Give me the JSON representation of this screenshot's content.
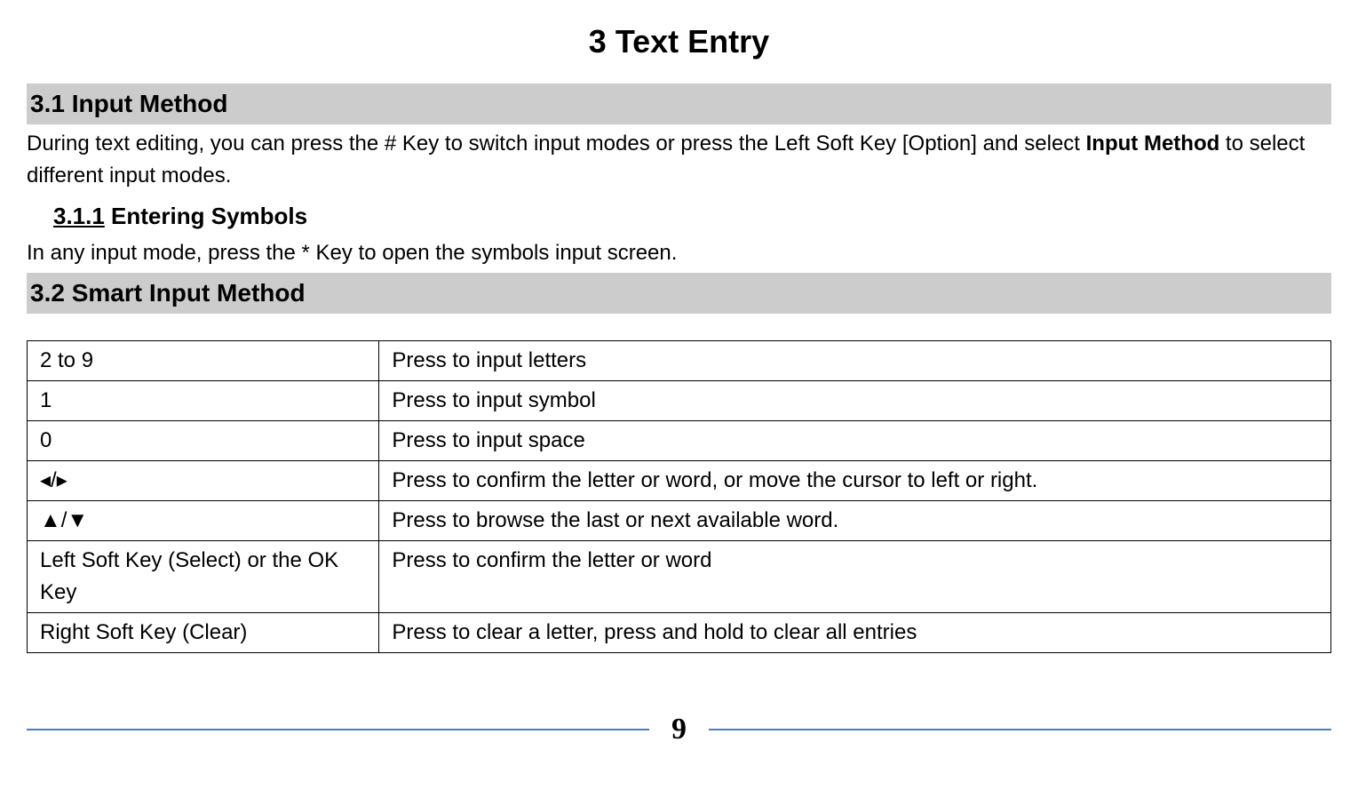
{
  "chapter_title": "3  Text Entry",
  "section_3_1": {
    "heading": "3.1 Input Method",
    "text_before_bold": "During text editing, you can press the # Key to switch input modes or press the Left Soft Key [Option] and select ",
    "bold": "Input Method",
    "text_after_bold": " to select different input modes."
  },
  "section_3_1_1": {
    "number": "3.1.1",
    "title": " Entering Symbols",
    "text": "In any input mode, press the * Key to open the symbols input screen."
  },
  "section_3_2": {
    "heading": "3.2 Smart Input Method"
  },
  "table": {
    "rows": [
      {
        "key": "2 to 9",
        "desc": "Press to input letters"
      },
      {
        "key": "1",
        "desc": "Press to input symbol"
      },
      {
        "key": "0",
        "desc": "Press to input space"
      },
      {
        "key": "◂/▸",
        "desc": "Press to confirm the letter or word, or move the cursor to left or right."
      },
      {
        "key": "▲/▼",
        "desc": "Press to browse the last or next available word."
      },
      {
        "key": "Left Soft Key (Select) or the OK Key",
        "desc": "Press to confirm the letter or word"
      },
      {
        "key": "Right Soft Key (Clear)",
        "desc": "Press to clear a letter, press and hold to clear all entries"
      }
    ]
  },
  "page_number": "9"
}
